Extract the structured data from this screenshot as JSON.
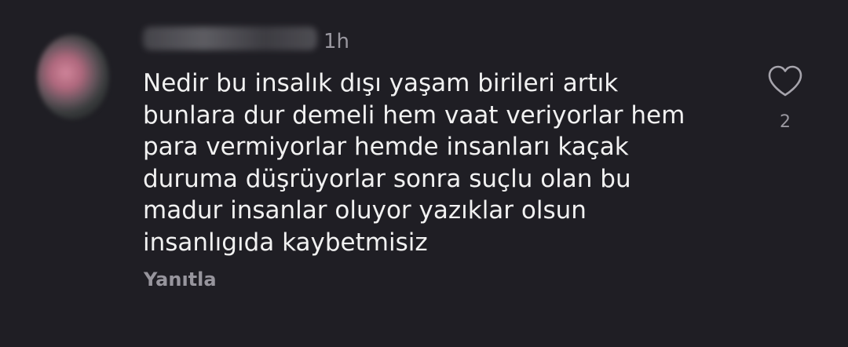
{
  "comment": {
    "timestamp": "1h",
    "text": "Nedir bu insalık dışı yaşam birileri artık\nbunlara dur demeli hem vaat veriyorlar hem\npara vermiyorlar hemde insanları kaçak\nduruma düşrüyorlar sonra suçlu olan bu\nmadur insanlar oluyor yazıklar olsun\ninsanlıgıda kaybetmisiz",
    "reply_label": "Yanıtla",
    "like_count": "2",
    "like_icon": "heart-outline-icon"
  }
}
